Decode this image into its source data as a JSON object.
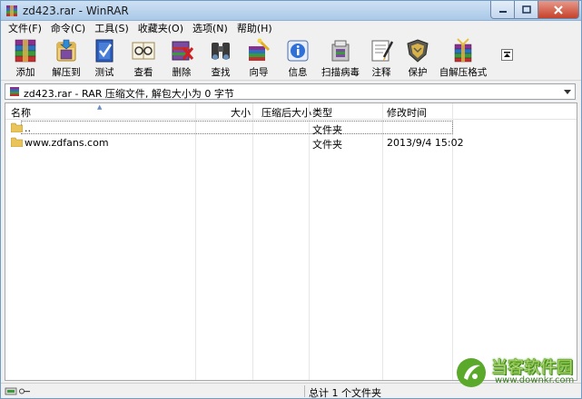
{
  "window": {
    "title": "zd423.rar - WinRAR"
  },
  "menu": {
    "items": [
      "文件(F)",
      "命令(C)",
      "工具(S)",
      "收藏夹(O)",
      "选项(N)",
      "帮助(H)"
    ]
  },
  "toolbar": {
    "buttons": [
      {
        "label": "添加",
        "icon": "add-books-icon"
      },
      {
        "label": "解压到",
        "icon": "extract-to-icon"
      },
      {
        "label": "测试",
        "icon": "test-icon"
      },
      {
        "label": "查看",
        "icon": "view-icon"
      },
      {
        "label": "删除",
        "icon": "delete-icon"
      },
      {
        "label": "查找",
        "icon": "find-binoculars-icon"
      },
      {
        "label": "向导",
        "icon": "wizard-icon"
      },
      {
        "label": "信息",
        "icon": "info-icon"
      },
      {
        "label": "扫描病毒",
        "icon": "virus-scan-icon"
      },
      {
        "label": "注释",
        "icon": "comment-icon"
      },
      {
        "label": "保护",
        "icon": "shield-icon"
      },
      {
        "label": "自解压格式",
        "icon": "sfx-icon"
      }
    ]
  },
  "address": {
    "text": "zd423.rar - RAR 压缩文件, 解包大小为 0 字节"
  },
  "columns": {
    "name": "名称",
    "size": "大小",
    "packed": "压缩后大小",
    "type": "类型",
    "modified": "修改时间"
  },
  "files": [
    {
      "name": "..",
      "size": "",
      "packed": "",
      "type": "文件夹",
      "modified": ""
    },
    {
      "name": "www.zdfans.com",
      "size": "",
      "packed": "",
      "type": "文件夹",
      "modified": "2013/9/4 15:02"
    }
  ],
  "status": {
    "text": "总计 1 个文件夹"
  },
  "watermark": {
    "title": "当客软件园",
    "url": "www.downkr.com"
  },
  "colors": {
    "titlebar": "#b9d3ee",
    "close_button": "#c6412a",
    "folder": "#e8c45a",
    "watermark_green": "#5aa92a"
  }
}
